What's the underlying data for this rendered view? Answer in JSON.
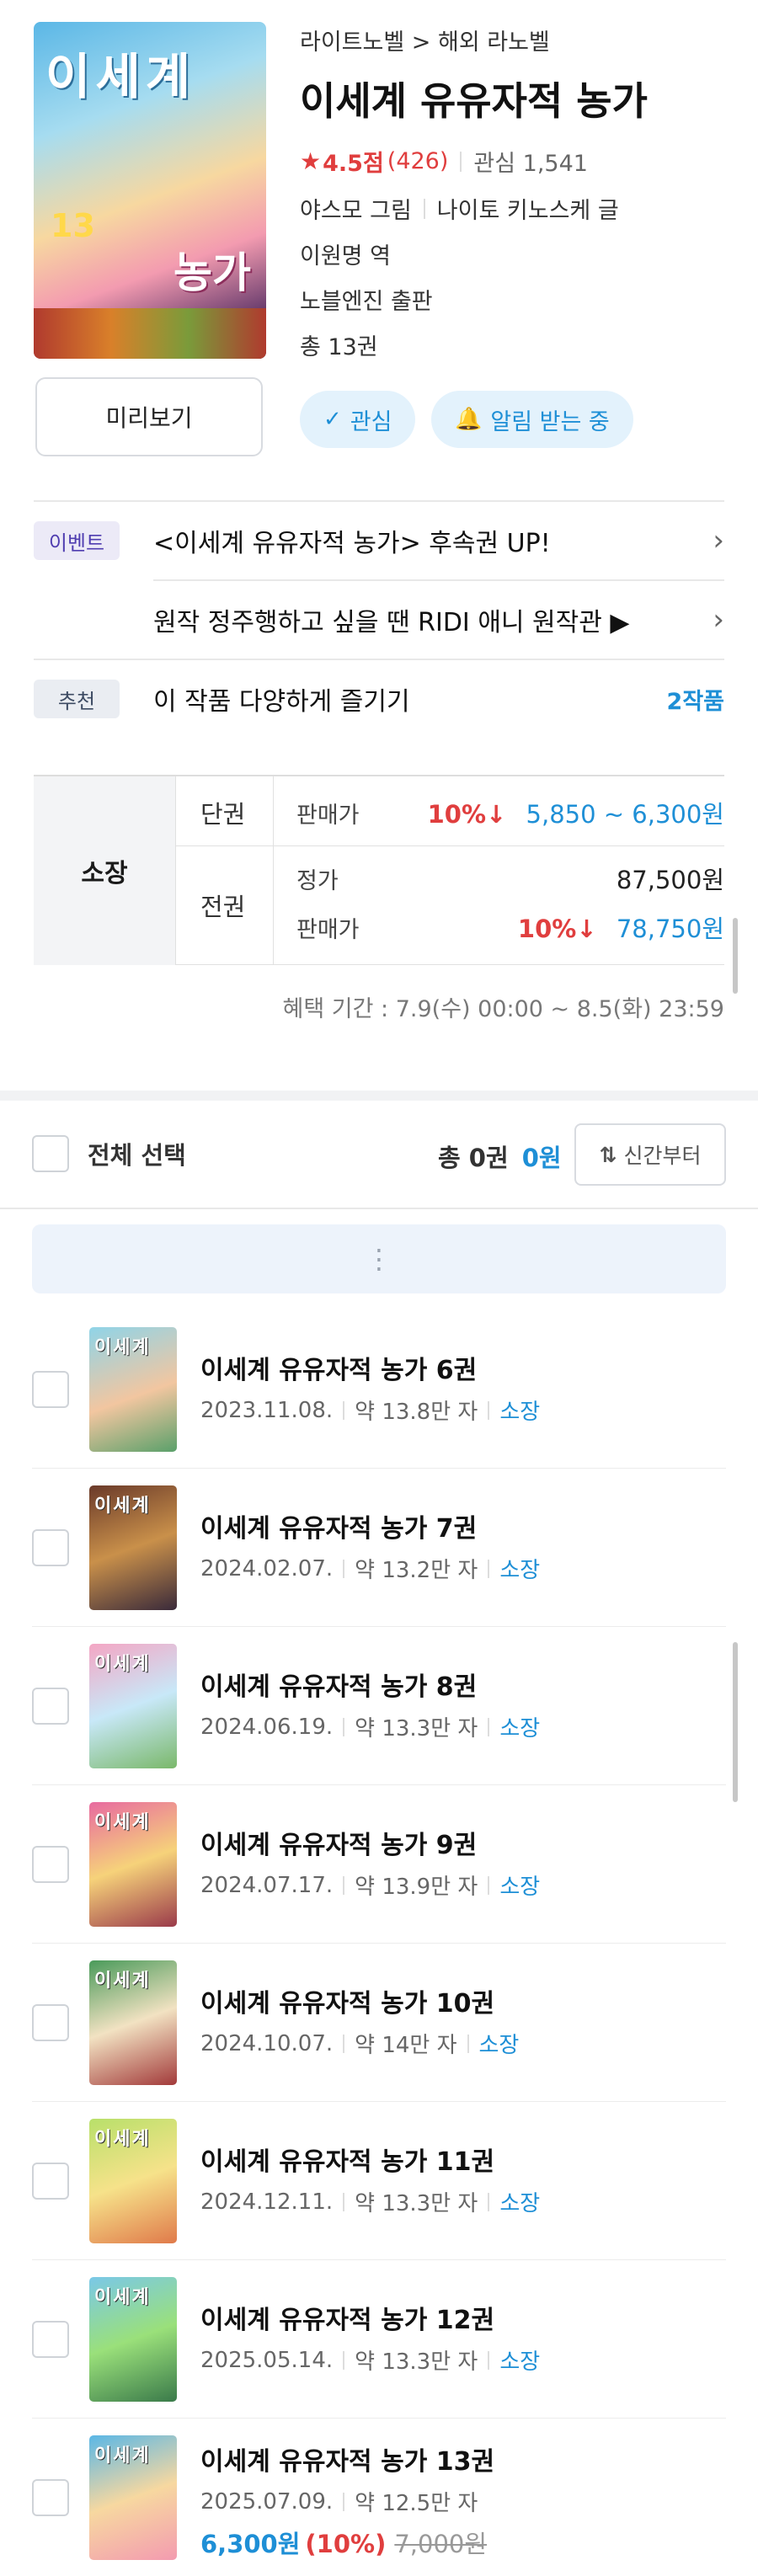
{
  "header": {
    "breadcrumb": "라이트노벨 > 해외 라노벨",
    "title": "이세계 유유자적 농가",
    "rating": "4.5점",
    "rating_count": "(426)",
    "interest": "관심 1,541",
    "illustrator": "야스모 그림",
    "author": "나이토 키노스케 글",
    "translator": "이원명 역",
    "publisher": "노블엔진 출판",
    "total": "총 13권",
    "cover_title": "이세계",
    "cover_subtitle": "농가",
    "cover_volume": "13"
  },
  "actions": {
    "preview": "미리보기",
    "interest": "관심",
    "interest_icon": "check-icon",
    "alarm": "알림 받는 중",
    "alarm_icon": "bell-icon"
  },
  "events": [
    {
      "tag": "이벤트",
      "text": "<이세계 유유자적 농가> 후속권 UP!"
    },
    {
      "tag": "",
      "text": "원작 정주행하고 싶을 땐 RIDI 애니 원작관 ▶"
    }
  ],
  "recommend": {
    "tag": "추천",
    "text": "이 작품 다양하게 즐기기",
    "link": "2작품"
  },
  "price": {
    "owned_label": "소장",
    "single_label": "단권",
    "single_sale_label": "판매가",
    "single_discount": "10%↓",
    "single_range": "5,850 ~ 6,300원",
    "set_label": "전권",
    "set_list_label": "정가",
    "set_list_price": "87,500원",
    "set_sale_label": "판매가",
    "set_discount": "10%↓",
    "set_sale_price": "78,750원",
    "period": "혜택 기간 : 7.9(수) 00:00 ~ 8.5(화) 23:59"
  },
  "list": {
    "select_all": "전체 선택",
    "total_prefix": "총 0권",
    "total_amount": "0원",
    "sort": "신간부터",
    "sort_icon": "sort-arrows-icon",
    "more_icon": "vertical-dots-icon",
    "items": [
      {
        "title": "이세계 유유자적 농가 6권",
        "date": "2023.11.08.",
        "length": "약 13.8만 자",
        "status": "소장"
      },
      {
        "title": "이세계 유유자적 농가 7권",
        "date": "2024.02.07.",
        "length": "약 13.2만 자",
        "status": "소장"
      },
      {
        "title": "이세계 유유자적 농가 8권",
        "date": "2024.06.19.",
        "length": "약 13.3만 자",
        "status": "소장"
      },
      {
        "title": "이세계 유유자적 농가 9권",
        "date": "2024.07.17.",
        "length": "약 13.9만 자",
        "status": "소장"
      },
      {
        "title": "이세계 유유자적 농가 10권",
        "date": "2024.10.07.",
        "length": "약 14만 자",
        "status": "소장"
      },
      {
        "title": "이세계 유유자적 농가 11권",
        "date": "2024.12.11.",
        "length": "약 13.3만 자",
        "status": "소장"
      },
      {
        "title": "이세계 유유자적 농가 12권",
        "date": "2025.05.14.",
        "length": "약 13.3만 자",
        "status": "소장"
      },
      {
        "title": "이세계 유유자적 농가 13권",
        "date": "2025.07.09.",
        "length": "약 12.5만 자",
        "status": "",
        "price": "6,300원",
        "discount": "(10%)",
        "original": "7,000원"
      }
    ]
  },
  "colors": {
    "accent": "#1e8fd6",
    "discount": "#e03e3e",
    "event_tag": "#4f3db0"
  }
}
